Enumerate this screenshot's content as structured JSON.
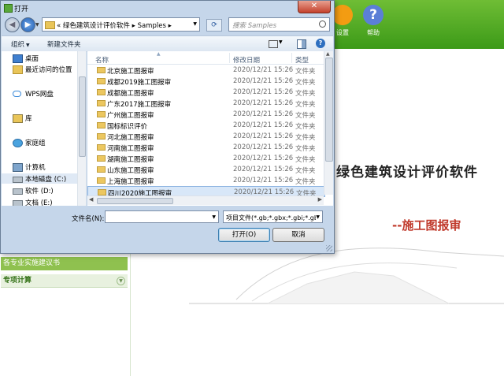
{
  "app": {
    "buttons": [
      {
        "label": "设置",
        "color": "#f39c12"
      },
      {
        "label": "帮助",
        "color": "#5b7fd6"
      }
    ],
    "title": "绿色建筑设计评价软件",
    "subtitle": "--施工图报审",
    "sidebar": {
      "item1": "各专业实施建议书",
      "item2": "专项计算"
    }
  },
  "dialog": {
    "title": "打开",
    "close": "✕",
    "address": {
      "path": "« 绿色建筑设计评价软件 ▸ Samples ▸"
    },
    "search": {
      "placeholder": "搜索 Samples"
    },
    "toolbar": {
      "organize": "组织",
      "new_folder": "新建文件夹",
      "help": "?"
    },
    "nav_items": [
      {
        "label": "桌面",
        "icon": "desktop-icon",
        "selected": false
      },
      {
        "label": "最近访问的位置",
        "icon": "recent-places-icon",
        "selected": false
      },
      {
        "label": "WPS网盘",
        "icon": "cloud-icon",
        "selected": false
      },
      {
        "label": "库",
        "icon": "library-icon",
        "selected": false
      },
      {
        "label": "家庭组",
        "icon": "homegroup-icon",
        "selected": false
      },
      {
        "label": "计算机",
        "icon": "computer-icon",
        "selected": false
      },
      {
        "label": "本地磁盘 (C:)",
        "icon": "drive-icon",
        "selected": true
      },
      {
        "label": "软件 (D:)",
        "icon": "drive-icon",
        "selected": false
      },
      {
        "label": "文档 (E:)",
        "icon": "drive-icon",
        "selected": false
      }
    ],
    "columns": {
      "name": "名称",
      "date": "修改日期",
      "type": "类型"
    },
    "files": [
      {
        "name": "北京施工图报审",
        "date": "2020/12/21 15:26",
        "type": "文件夹",
        "selected": false
      },
      {
        "name": "成都2019施工图报审",
        "date": "2020/12/21 15:26",
        "type": "文件夹",
        "selected": false
      },
      {
        "name": "成都施工图报审",
        "date": "2020/12/21 15:26",
        "type": "文件夹",
        "selected": false
      },
      {
        "name": "广东2017施工图报审",
        "date": "2020/12/21 15:26",
        "type": "文件夹",
        "selected": false
      },
      {
        "name": "广州施工图报审",
        "date": "2020/12/21 15:26",
        "type": "文件夹",
        "selected": false
      },
      {
        "name": "国标标识评价",
        "date": "2020/12/21 15:26",
        "type": "文件夹",
        "selected": false
      },
      {
        "name": "河北施工图报审",
        "date": "2020/12/21 15:26",
        "type": "文件夹",
        "selected": false
      },
      {
        "name": "河南施工图报审",
        "date": "2020/12/21 15:26",
        "type": "文件夹",
        "selected": false
      },
      {
        "name": "湖南施工图报审",
        "date": "2020/12/21 15:26",
        "type": "文件夹",
        "selected": false
      },
      {
        "name": "山东施工图报审",
        "date": "2020/12/21 15:26",
        "type": "文件夹",
        "selected": false
      },
      {
        "name": "上海施工图报审",
        "date": "2020/12/21 15:26",
        "type": "文件夹",
        "selected": false
      },
      {
        "name": "四川2020施工图报审",
        "date": "2020/12/21 15:26",
        "type": "文件夹",
        "selected": true
      }
    ],
    "filename_label": "文件名(N):",
    "filename_value": "",
    "filetype": "项目文件(*.gb;*.gbx;*.gbi;*.gb",
    "open_button": "打开(O)",
    "cancel_button": "取消"
  }
}
